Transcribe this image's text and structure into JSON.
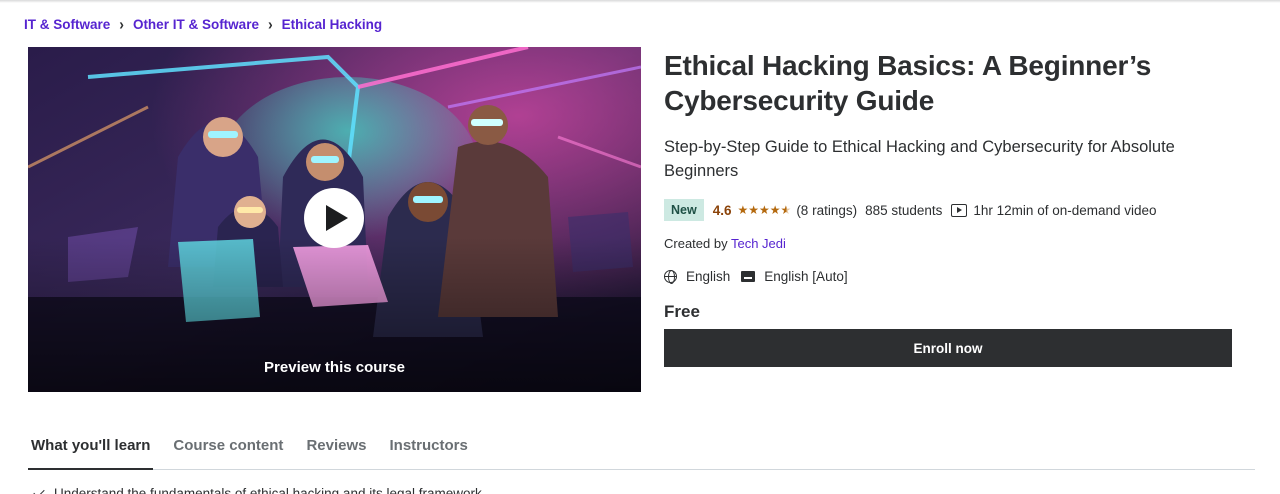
{
  "breadcrumb": {
    "items": [
      {
        "label": "IT & Software"
      },
      {
        "label": "Other IT & Software"
      },
      {
        "label": "Ethical Hacking"
      }
    ],
    "separator": "›"
  },
  "preview": {
    "label": "Preview this course",
    "icon": "play-icon"
  },
  "course": {
    "title": "Ethical Hacking Basics: A Beginner’s Cybersecurity Guide",
    "subtitle": "Step-by-Step Guide to Ethical Hacking and Cybersecurity for Absolute Beginners",
    "badge": "New",
    "rating": "4.6",
    "rating_value": 4.6,
    "rating_max": 5,
    "ratings_count": "(8 ratings)",
    "students": "885 students",
    "video_length": "1hr 12min of on-demand video",
    "created_by_label": "Created by",
    "instructor": "Tech Jedi",
    "language": "English",
    "captions": "English [Auto]",
    "price": "Free",
    "enroll_label": "Enroll now"
  },
  "tabs": [
    {
      "label": "What you'll learn",
      "active": true
    },
    {
      "label": "Course content",
      "active": false
    },
    {
      "label": "Reviews",
      "active": false
    },
    {
      "label": "Instructors",
      "active": false
    }
  ],
  "learn": {
    "first_item": "Understand the fundamentals of ethical hacking and its legal framework"
  },
  "colors": {
    "accent": "#5624d0",
    "star": "#b4690e",
    "rating_text": "#8b4309",
    "badge_bg": "#cde9e2",
    "button_bg": "#2d2f31"
  }
}
